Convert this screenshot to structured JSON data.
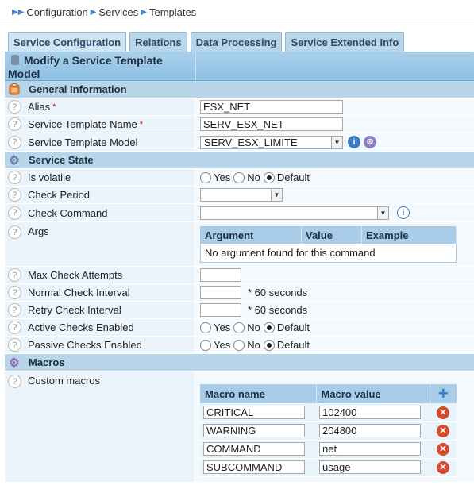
{
  "breadcrumb": [
    "Configuration",
    "Services",
    "Templates"
  ],
  "tabs": [
    {
      "label": "Service Configuration",
      "active": true
    },
    {
      "label": "Relations",
      "active": false
    },
    {
      "label": "Data Processing",
      "active": false
    },
    {
      "label": "Service Extended Info",
      "active": false
    }
  ],
  "form": {
    "title_line1": "Modify a Service Template",
    "title_line2": "Model",
    "help_glyph": "?",
    "required_mark": "*",
    "general": {
      "section": "General Information",
      "alias_label": "Alias",
      "alias_value": "ESX_NET",
      "name_label": "Service Template Name",
      "name_value": "SERV_ESX_NET",
      "model_label": "Service Template Model",
      "model_value": "SERV_ESX_LIMITE"
    },
    "state": {
      "section": "Service State",
      "volatile_label": "Is volatile",
      "radio_yes": "Yes",
      "radio_no": "No",
      "radio_default": "Default",
      "check_period_label": "Check Period",
      "check_period_value": "",
      "check_command_label": "Check Command",
      "check_command_value": "",
      "args_label": "Args",
      "args_headers": [
        "Argument",
        "Value",
        "Example"
      ],
      "args_empty": "No argument found for this command",
      "max_attempts_label": "Max Check Attempts",
      "max_attempts_value": "",
      "normal_interval_label": "Normal Check Interval",
      "normal_interval_value": "",
      "retry_interval_label": "Retry Check Interval",
      "retry_interval_value": "",
      "seconds_suffix": "* 60 seconds",
      "active_label": "Active Checks Enabled",
      "passive_label": "Passive Checks Enabled"
    },
    "macros": {
      "section": "Macros",
      "custom_label": "Custom macros",
      "name_header": "Macro name",
      "value_header": "Macro value",
      "rows": [
        {
          "name": "CRITICAL",
          "value": "102400"
        },
        {
          "name": "WARNING",
          "value": "204800"
        },
        {
          "name": "COMMAND",
          "value": "net"
        },
        {
          "name": "SUBCOMMAND",
          "value": "usage"
        }
      ]
    }
  },
  "colors": {
    "accent": "#4a86c8",
    "header": "#a9cde8",
    "section": "#b8d5ea",
    "delete": "#d94a2a"
  }
}
